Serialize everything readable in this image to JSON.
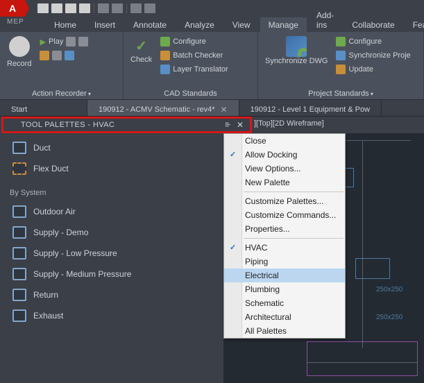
{
  "app": {
    "logo": "A",
    "sub": "MEP"
  },
  "ribbon_tabs": [
    "Home",
    "Insert",
    "Annotate",
    "Analyze",
    "View",
    "Manage",
    "Add-ins",
    "Collaborate",
    "Feat"
  ],
  "ribbon_active": 5,
  "ribbon": {
    "record": "Record",
    "play": "Play",
    "action_recorder": "Action Recorder",
    "check": "Check",
    "configure": "Configure",
    "batch_checker": "Batch Checker",
    "layer_translator": "Layer Translator",
    "cad_standards": "CAD Standards",
    "sync_dwg": "Synchronize DWG",
    "sync_proj": "Synchronize Proje",
    "update": "Update",
    "proj_standards": "Project Standards"
  },
  "doc_tabs": [
    {
      "label": "Start",
      "active": false,
      "closable": false
    },
    {
      "label": "190912 - ACMV Schematic - rev4*",
      "active": true,
      "closable": true
    },
    {
      "label": "190912 - Level 1 Equipment & Pow",
      "active": false,
      "closable": false
    }
  ],
  "palette": {
    "title": "TOOL PALETTES - HVAC",
    "view_label": "][Top][2D Wireframe]",
    "items_top": [
      "Duct",
      "Flex Duct"
    ],
    "section": "By System",
    "items_system": [
      "Outdoor Air",
      "Supply - Demo",
      "Supply - Low Pressure",
      "Supply - Medium Pressure",
      "Return",
      "Exhaust"
    ]
  },
  "context_menu": {
    "groups": [
      [
        "Close",
        "Allow Docking",
        "View Options...",
        "New Palette"
      ],
      [
        "Customize Palettes...",
        "Customize Commands...",
        "Properties..."
      ],
      [
        "HVAC",
        "Piping",
        "Electrical",
        "Plumbing",
        "Schematic",
        "Architectural",
        "All Palettes"
      ]
    ],
    "checked": [
      "Allow Docking",
      "HVAC"
    ],
    "highlighted": "Electrical"
  },
  "schematic": {
    "dim": "250x250"
  }
}
